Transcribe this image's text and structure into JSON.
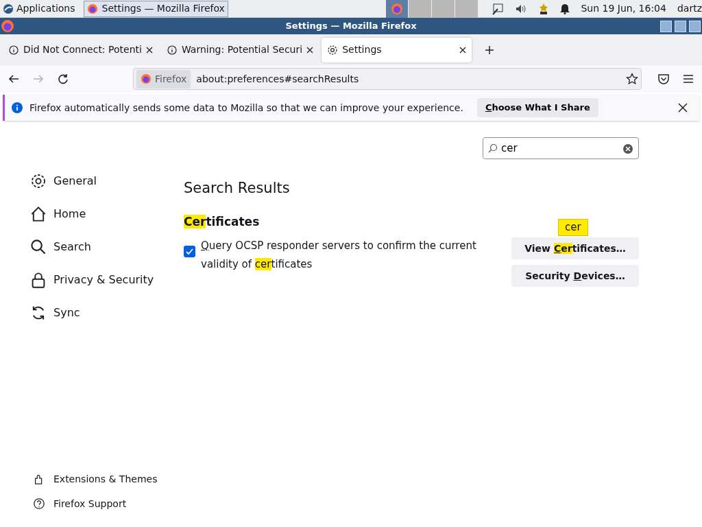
{
  "taskbar": {
    "apps_menu": "Applications",
    "tasks": [
      {
        "label": "Settings — Mozilla Firefox",
        "selected": true
      }
    ],
    "clock": "Sun 19 Jun, 16:04",
    "user": "dartz"
  },
  "window": {
    "title": "Settings — Mozilla Firefox"
  },
  "tabs": [
    {
      "label": "Did Not Connect: Potenti",
      "selected": false
    },
    {
      "label": "Warning: Potential Securi",
      "selected": false
    },
    {
      "label": "Settings",
      "selected": true
    }
  ],
  "navbar": {
    "identity": "Firefox",
    "url": "about:preferences#searchResults",
    "forward_disabled": true
  },
  "notification": {
    "message": "Firefox automatically sends some data to Mozilla so that we can improve your experience.",
    "button": [
      {
        "t": "C",
        "ul": true
      },
      {
        "t": "hoose What I Share"
      }
    ]
  },
  "search": {
    "value": "cer"
  },
  "sidebar": {
    "items": [
      {
        "label": "General"
      },
      {
        "label": "Home"
      },
      {
        "label": "Search"
      },
      {
        "label": "Privacy & Security"
      },
      {
        "label": "Sync"
      }
    ],
    "footer": [
      {
        "label": "Extensions & Themes"
      },
      {
        "label": "Firefox Support"
      }
    ]
  },
  "heading": "Search Results",
  "section": {
    "title": [
      {
        "t": "Cer",
        "hl": true
      },
      {
        "t": "tificates"
      }
    ],
    "checkbox": {
      "checked": true,
      "label": [
        {
          "t": "Q",
          "ul": true
        },
        {
          "t": "uery OCSP responder servers to confirm the current validity of "
        },
        {
          "t": "cer",
          "hl": true
        },
        {
          "t": "tificates"
        }
      ]
    },
    "buttons": [
      {
        "label": [
          {
            "t": "View "
          },
          {
            "t": "C",
            "ul": true,
            "hl": true
          },
          {
            "t": "er",
            "hl": true
          },
          {
            "t": "tificates…"
          }
        ],
        "tooltip": "cer"
      },
      {
        "label": [
          {
            "t": "Security "
          },
          {
            "t": "D",
            "ul": true
          },
          {
            "t": "evices…"
          }
        ]
      }
    ]
  }
}
